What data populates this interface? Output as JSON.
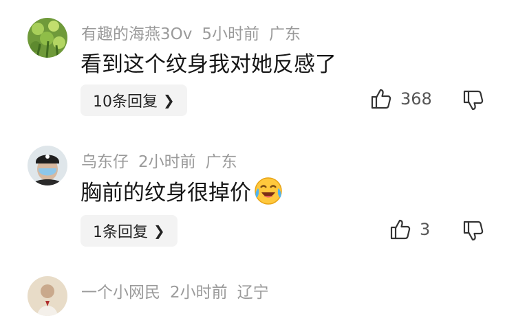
{
  "comments": [
    {
      "username": "有趣的海燕3Ov",
      "time": "5小时前",
      "location": "广东",
      "text": "看到这个纹身我对她反感了",
      "reply_label": "10条回复",
      "likes": "368",
      "avatar_icon": "green-plant-avatar"
    },
    {
      "username": "乌东仔",
      "time": "2小时前",
      "location": "广东",
      "text": "胸前的纹身很掉价",
      "emoji": "laughing-crying-emoji",
      "reply_label": "1条回复",
      "likes": "3",
      "avatar_icon": "person-cap-avatar"
    },
    {
      "username": "一个小网民",
      "time": "2小时前",
      "location": "辽宁",
      "avatar_icon": "person-avatar"
    }
  ],
  "colors": {
    "meta": "#9a9a9a",
    "text": "#161616",
    "reply_bg": "#f3f3f3"
  }
}
